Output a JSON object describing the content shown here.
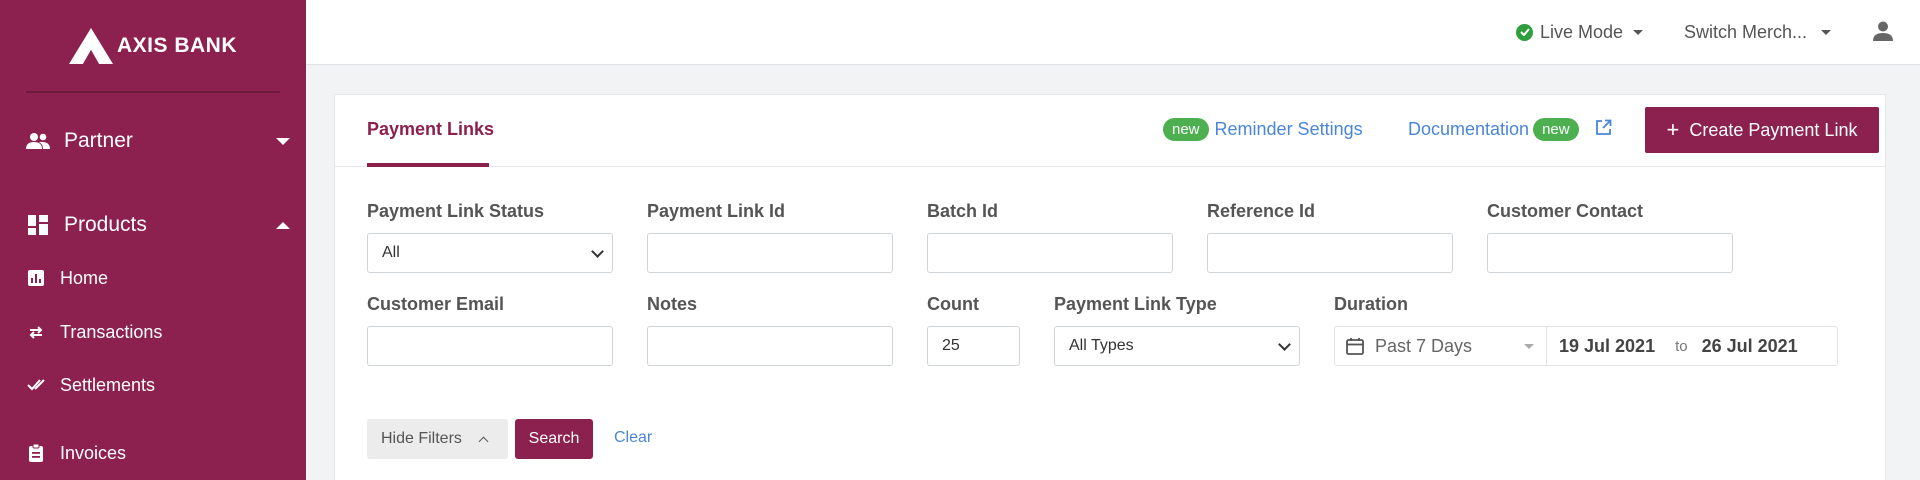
{
  "brand": {
    "name": "AXIS BANK",
    "color": "#8c204e"
  },
  "sidebar": {
    "sections": [
      {
        "label": "Partner",
        "icon": "people-icon",
        "expanded": false
      },
      {
        "label": "Products",
        "icon": "dashboard-icon",
        "expanded": true
      }
    ],
    "items": [
      {
        "label": "Home",
        "icon": "chart-icon"
      },
      {
        "label": "Transactions",
        "icon": "transfer-icon"
      },
      {
        "label": "Settlements",
        "icon": "double-check-icon"
      },
      {
        "label": "Invoices",
        "icon": "clipboard-icon"
      }
    ]
  },
  "topbar": {
    "mode_label": "Live Mode",
    "mode_status_color": "#2e9e3e",
    "merchant_label": "Switch Merch..."
  },
  "tabs": {
    "active_label": "Payment Links",
    "reminder_badge": "new",
    "reminder_label": "Reminder Settings",
    "docs_label": "Documentation",
    "docs_badge": "new",
    "create_button": "Create Payment Link"
  },
  "filters": {
    "status": {
      "label": "Payment Link Status",
      "value": "All"
    },
    "link_id": {
      "label": "Payment Link Id",
      "value": ""
    },
    "batch_id": {
      "label": "Batch Id",
      "value": ""
    },
    "reference_id": {
      "label": "Reference Id",
      "value": ""
    },
    "customer_contact": {
      "label": "Customer Contact",
      "value": ""
    },
    "customer_email": {
      "label": "Customer Email",
      "value": ""
    },
    "notes": {
      "label": "Notes",
      "value": ""
    },
    "count": {
      "label": "Count",
      "value": "25"
    },
    "link_type": {
      "label": "Payment Link Type",
      "value": "All Types"
    },
    "duration": {
      "label": "Duration",
      "range": "Past 7 Days",
      "from": "19 Jul 2021",
      "to_label": "to",
      "to": "26 Jul 2021"
    }
  },
  "actions": {
    "hide_filters": "Hide Filters",
    "search": "Search",
    "clear": "Clear"
  }
}
